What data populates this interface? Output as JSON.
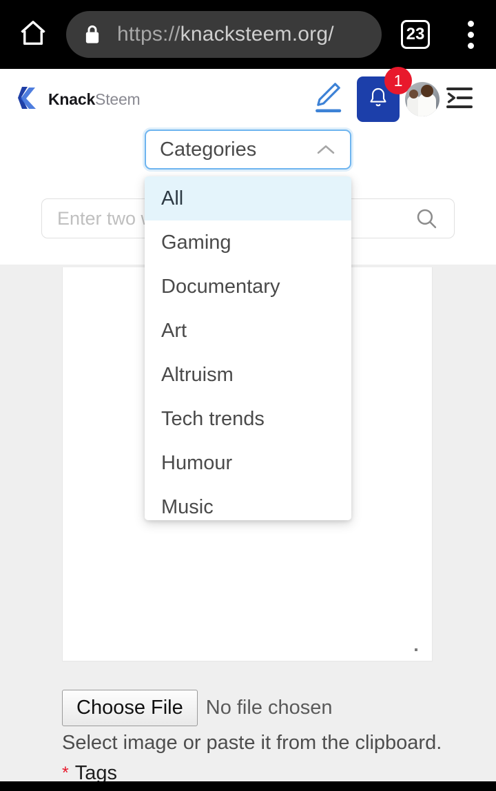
{
  "browser": {
    "home_icon": "home-icon",
    "lock_icon": "lock-icon",
    "url_scheme": "https://",
    "url_host": "knacksteem.org/",
    "tab_count": "23",
    "menu_icon": "kebab-menu-icon"
  },
  "app_header": {
    "brand_bold": "Knack",
    "brand_light": "Steem",
    "edit_icon": "pencil-edit-icon",
    "bell_icon": "bell-icon",
    "notification_badge": "1",
    "avatar_label": "user-avatar",
    "menu_fold_icon": "menu-fold-icon"
  },
  "search": {
    "placeholder": "Enter two words to search",
    "icon": "search-icon"
  },
  "categories_select": {
    "placeholder": "Categories",
    "caret_icon": "chevron-up-icon",
    "options": [
      {
        "label": "All",
        "selected": true
      },
      {
        "label": "Gaming",
        "selected": false
      },
      {
        "label": "Documentary",
        "selected": false
      },
      {
        "label": "Art",
        "selected": false
      },
      {
        "label": "Altruism",
        "selected": false
      },
      {
        "label": "Tech trends",
        "selected": false
      },
      {
        "label": "Humour",
        "selected": false
      },
      {
        "label": "Music",
        "selected": false
      }
    ]
  },
  "form": {
    "choose_file_label": "Choose File",
    "no_file_text": "No file chosen",
    "hint": "Select image or paste it from the clipboard.",
    "tags_required_mark": "*",
    "tags_label": "Tags"
  },
  "colors": {
    "accent_blue": "#1c3faa",
    "focus_blue": "#6eb4ef",
    "badge_red": "#e8192c",
    "selected_row": "#e4f4fb",
    "page_bg": "#efefef"
  }
}
